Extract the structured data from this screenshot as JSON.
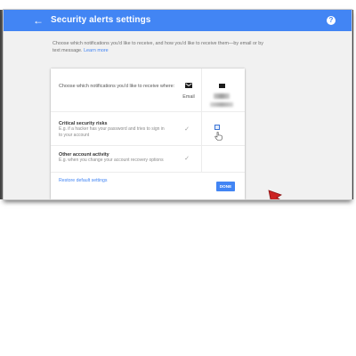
{
  "colors": {
    "appbar": "#4285f4",
    "link": "#4285f4",
    "arrow": "#cc2323"
  },
  "appbar": {
    "back_icon": "arrow-back-icon",
    "title": "Security alerts settings",
    "help_icon": "help-icon",
    "help_glyph": "?"
  },
  "intro": {
    "text": "Choose which notifications you'd like to receive, and how you'd like to receive them—by email or by text message.",
    "link": "Learn more"
  },
  "table": {
    "header_label": "Choose which notifications you'd like to receive where:",
    "columns": [
      {
        "icon": "email-icon",
        "label": "Email"
      },
      {
        "icon": "phone-icon",
        "label": ""
      }
    ],
    "rows": [
      {
        "title": "Critical security risks",
        "description": "E.g. if a hacker has your password and tries to sign in to your account",
        "email_checked": true,
        "other_checked": false
      },
      {
        "title": "Other account activity",
        "description": "E.g. when you change your account recovery options",
        "email_checked": true,
        "other_checked": false
      }
    ],
    "check_glyph": "✓"
  },
  "restore_label": "Restore default settings",
  "done_label": "DONE"
}
